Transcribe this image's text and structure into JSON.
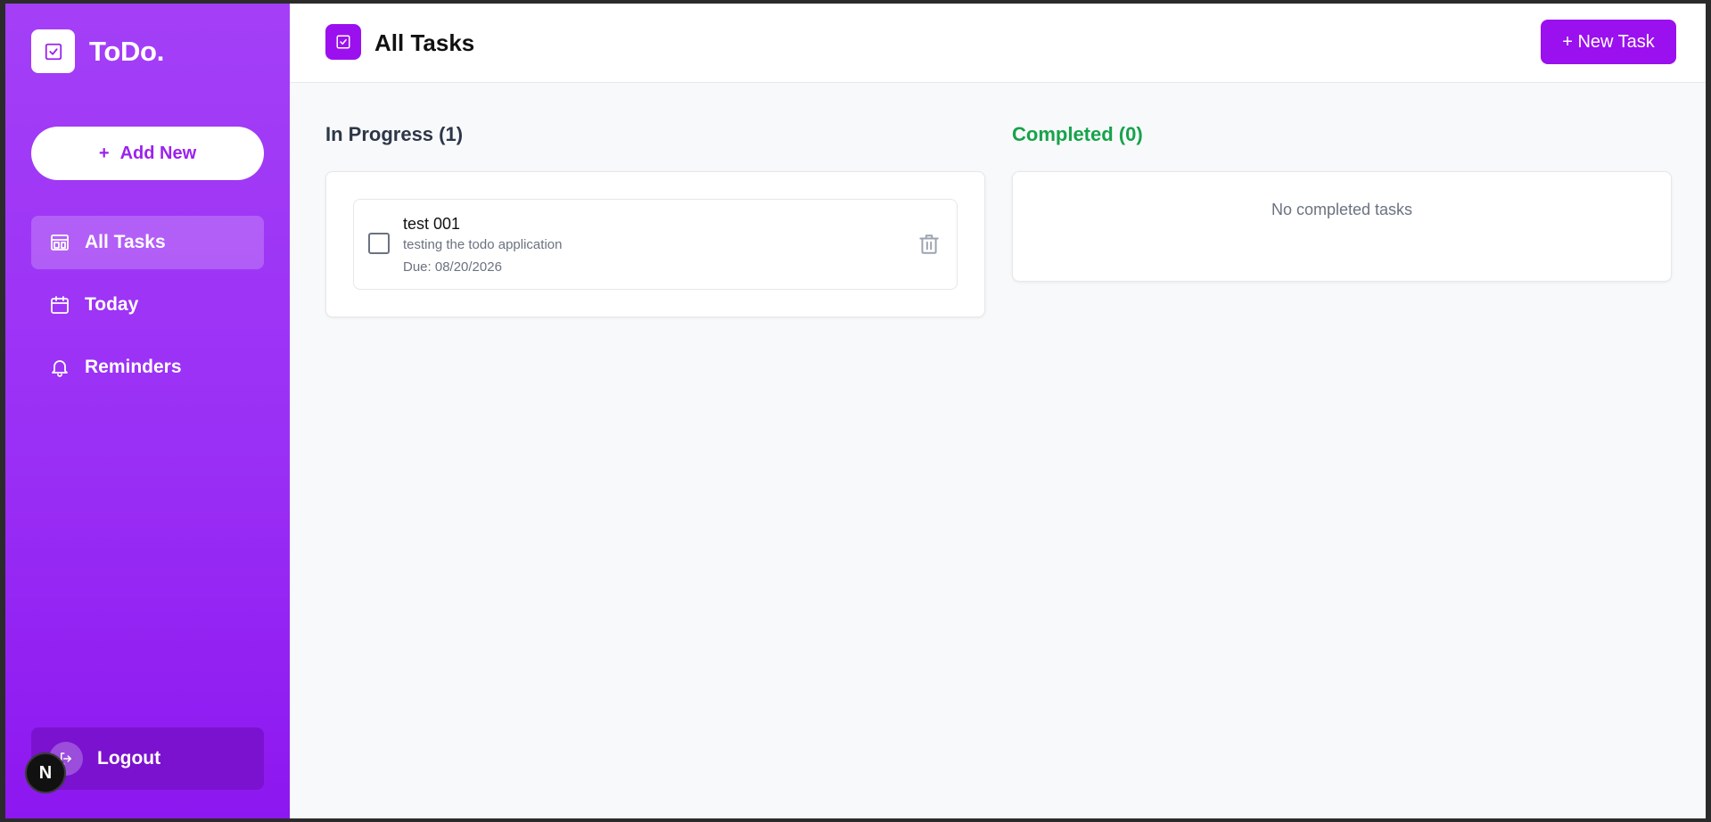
{
  "brand": {
    "name": "ToDo."
  },
  "sidebar": {
    "add_new_label": "Add New",
    "add_new_plus": "+",
    "items": [
      {
        "label": "All Tasks",
        "icon": "layout-icon",
        "active": true
      },
      {
        "label": "Today",
        "icon": "calendar-icon",
        "active": false
      },
      {
        "label": "Reminders",
        "icon": "bell-icon",
        "active": false
      }
    ],
    "logout_label": "Logout"
  },
  "dev_badge": {
    "letter": "N"
  },
  "header": {
    "title": "All Tasks",
    "new_task_label": "+ New Task"
  },
  "columns": {
    "in_progress": {
      "title": "In Progress (1)",
      "tasks": [
        {
          "title": "test 001",
          "description": "testing the todo application",
          "due": "Due: 08/20/2026",
          "checked": false
        }
      ]
    },
    "completed": {
      "title": "Completed (0)",
      "empty_text": "No completed tasks"
    }
  },
  "colors": {
    "accent": "#9b10ee",
    "sidebar_top": "#a43ff7",
    "sidebar_bottom": "#8d17f0",
    "completed_green": "#16a34a"
  }
}
